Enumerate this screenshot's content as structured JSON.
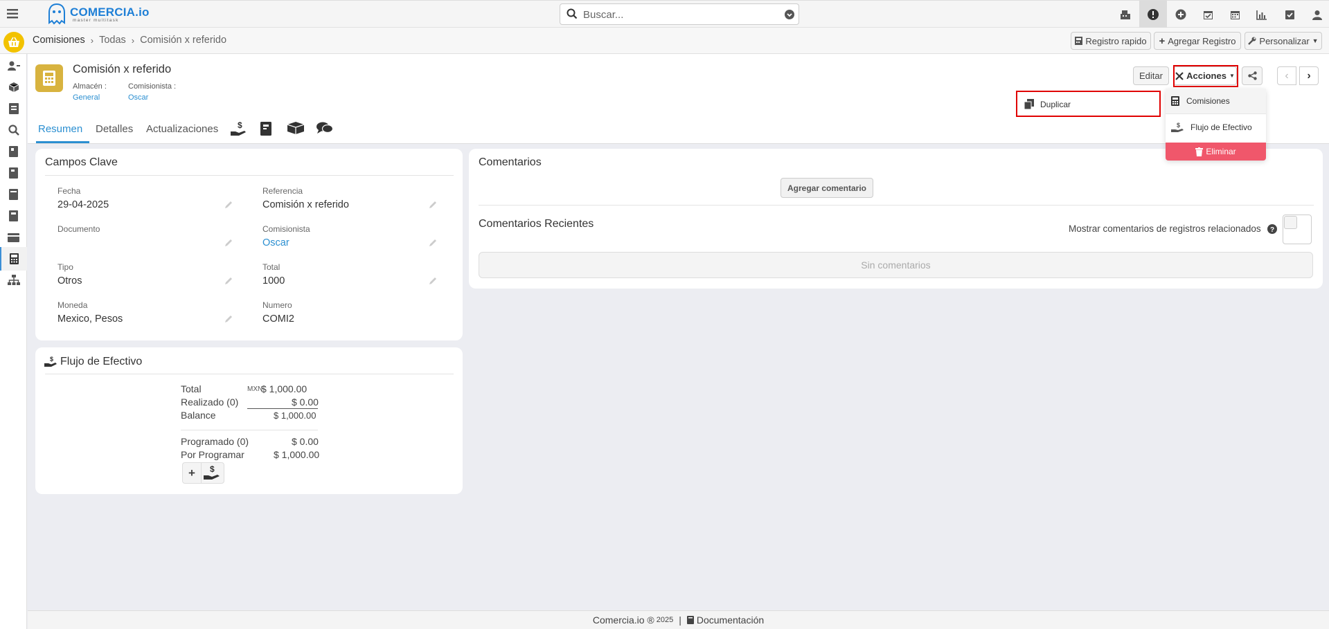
{
  "brand": {
    "name": "COMERCIA.io",
    "tagline": "master multitask"
  },
  "search": {
    "placeholder": "Buscar..."
  },
  "top_icons": [
    "register-icon",
    "alert-icon",
    "add-circle-icon",
    "calendar-check-icon",
    "calendar-icon",
    "chart-icon",
    "task-check-icon",
    "user-icon"
  ],
  "breadcrumb": {
    "root": "Comisiones",
    "level2": "Todas",
    "current": "Comisión x referido"
  },
  "toolbar": {
    "quick": "Registro rapido",
    "add": "Agregar Registro",
    "customize": "Personalizar"
  },
  "record": {
    "title": "Comisión x referido",
    "almacen_label": "Almacén :",
    "almacen_value": "General",
    "comisionista_label": "Comisionista :",
    "comisionista_value": "Oscar",
    "edit_label": "Editar",
    "actions_label": "Acciones"
  },
  "tabs": [
    "Resumen",
    "Detalles",
    "Actualizaciones"
  ],
  "actions_menu": {
    "duplicate": "Duplicar",
    "comisiones": "Comisiones",
    "flujo": "Flujo de Efectivo",
    "delete": "Eliminar"
  },
  "key_fields": {
    "title": "Campos Clave",
    "fecha_label": "Fecha",
    "fecha": "29-04-2025",
    "referencia_label": "Referencia",
    "referencia": "Comisión x referido",
    "documento_label": "Documento",
    "documento": "",
    "comisionista_label": "Comisionista",
    "comisionista": "Oscar",
    "tipo_label": "Tipo",
    "tipo": "Otros",
    "total_label": "Total",
    "total": "1000",
    "moneda_label": "Moneda",
    "moneda": "Mexico, Pesos",
    "numero_label": "Numero",
    "numero": "COMI2"
  },
  "cash_flow": {
    "title": "Flujo de Efectivo",
    "total_label": "Total",
    "currency": "MXN",
    "total": "$ 1,000.00",
    "realizado_label": "Realizado (0)",
    "realizado": "$ 0.00",
    "balance_label": "Balance",
    "balance": "$ 1,000.00",
    "programado_label": "Programado (0)",
    "programado": "$ 0.00",
    "por_programar_label": "Por Programar",
    "por_programar": "$ 1,000.00"
  },
  "comments": {
    "title": "Comentarios",
    "add_button": "Agregar comentario",
    "recent_title": "Comentarios Recientes",
    "related_toggle_label": "Mostrar comentarios de registros relacionados",
    "empty": "Sin comentarios"
  },
  "footer": {
    "text": "Comercia.io ® ",
    "year": "2025",
    "docs": "Documentación"
  },
  "colors": {
    "accent": "#2b8fd1",
    "danger": "#f0576b",
    "highlight": "#e00000",
    "brand_yellow": "#f2c200"
  }
}
